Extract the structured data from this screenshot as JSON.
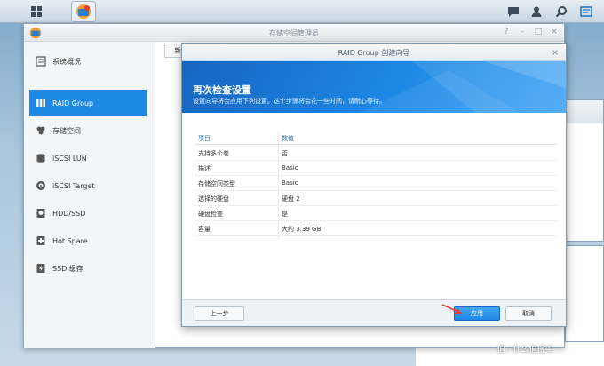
{
  "taskbar": {
    "icons": [
      "main-menu-icon",
      "storage-manager-icon",
      "chat-icon",
      "user-icon",
      "search-icon",
      "widgets-icon"
    ]
  },
  "window": {
    "title": "存储空间管理员",
    "new_button_label": "新"
  },
  "sidebar": {
    "items": [
      {
        "label": "系统概况",
        "icon": "overview-icon"
      },
      {
        "label": "RAID Group",
        "icon": "raid-group-icon",
        "active": true
      },
      {
        "label": "存储空间",
        "icon": "volume-icon"
      },
      {
        "label": "iSCSI LUN",
        "icon": "iscsi-lun-icon"
      },
      {
        "label": "iSCSI Target",
        "icon": "iscsi-target-icon"
      },
      {
        "label": "HDD/SSD",
        "icon": "hdd-icon"
      },
      {
        "label": "Hot Spare",
        "icon": "hot-spare-icon"
      },
      {
        "label": "SSD 缓存",
        "icon": "ssd-cache-icon"
      }
    ]
  },
  "dialog": {
    "title": "RAID Group 创建向导",
    "heading": "再次检查设置",
    "subtitle": "设置向导将会应用下列设置。这个步骤将会花一些时间，请耐心等待。",
    "table": {
      "headers": [
        "项目",
        "数值"
      ],
      "rows": [
        [
          "支持多个卷",
          "否"
        ],
        [
          "描述",
          "Basic"
        ],
        [
          "存储空间类型",
          "Basic"
        ],
        [
          "选择的硬盘",
          "硬盘 2"
        ],
        [
          "硬盘检查",
          "是"
        ],
        [
          "容量",
          "大约 3.39 GB"
        ]
      ]
    },
    "buttons": {
      "prev": "上一步",
      "apply": "应用",
      "cancel": "取消"
    }
  },
  "watermark": "值 · 什么值得买",
  "colors": {
    "accent": "#1e88e5",
    "banner_dark": "#1565c0",
    "header_text": "#1e6fb8"
  }
}
